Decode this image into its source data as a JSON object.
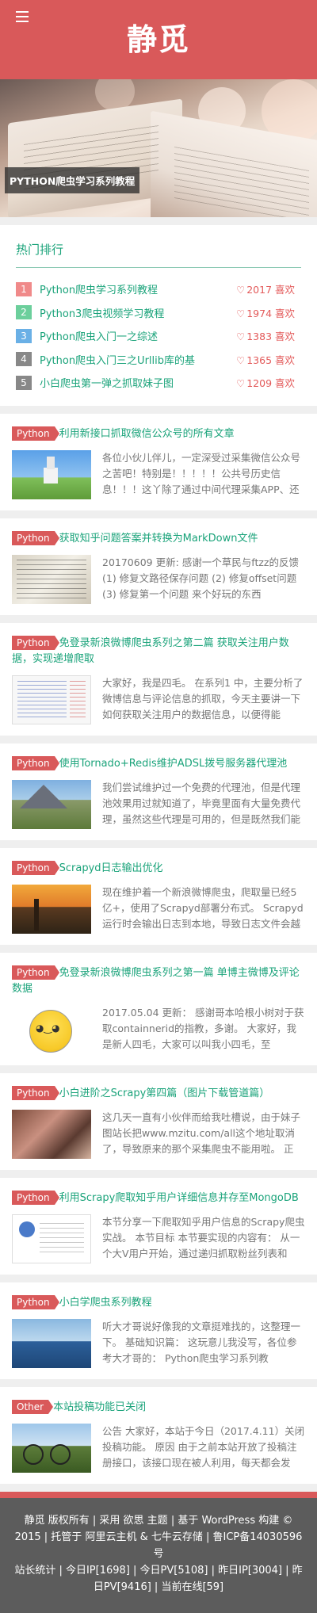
{
  "site": {
    "title": "静觅"
  },
  "banner": {
    "caption": "PYTHON爬虫学习系列教程"
  },
  "hot": {
    "title": "热门排行",
    "items": [
      {
        "rank": "1",
        "title": "Python爬虫学习系列教程",
        "likes": "2017 喜欢",
        "color": "#f08a8a"
      },
      {
        "rank": "2",
        "title": "Python3爬虫视频学习教程",
        "likes": "1974 喜欢",
        "color": "#6ccf9c"
      },
      {
        "rank": "3",
        "title": "Python爬虫入门一之综述",
        "likes": "1383 喜欢",
        "color": "#6ab0e6"
      },
      {
        "rank": "4",
        "title": "Python爬虫入门三之Urllib库的基",
        "likes": "1365 喜欢",
        "color": "#888888"
      },
      {
        "rank": "5",
        "title": "小白爬虫第一弹之抓取妹子图",
        "likes": "1209 喜欢",
        "color": "#888888"
      }
    ]
  },
  "posts": [
    {
      "category": "Python",
      "title": "利用新接口抓取微信公众号的所有文章",
      "excerpt": "各位小伙儿伴儿，一定深受过采集微信公众号之苦吧！特别是！！！！！公共号历史信息！！！这丫除了通过中间代理采集APP、还",
      "thumb": "t-church"
    },
    {
      "category": "Python",
      "title": "获取知乎问题答案并转换为MarkDown文件",
      "excerpt": "20170609 更新: 感谢一个草民与ftzz的反馈 (1) 修复文路径保存问题 (2) 修复offset问题 (3) 修复第一个问题 来个好玩的东西",
      "thumb": "t-notes"
    },
    {
      "category": "Python",
      "title": "免登录新浪微博爬虫系列之第二篇 获取关注用户数据，实现递增爬取",
      "excerpt": "大家好，我是四毛。 在系列1 中，主要分析了微博信息与评论信息的抓取，今天主要讲一下如何获取关注用户的数据信息，以便得能",
      "thumb": "t-code"
    },
    {
      "category": "Python",
      "title": "使用Tornado+Redis维护ADSL拨号服务器代理池",
      "excerpt": "我们尝试维护过一个免费的代理池，但是代理池效果用过就知道了，毕竟里面有大量免费代理，虽然这些代理是可用的，但是既然我们能",
      "thumb": "t-mountain"
    },
    {
      "category": "Python",
      "title": "Scrapyd日志输出优化",
      "excerpt": "现在维护着一个新浪微博爬虫，爬取量已经5亿+，使用了Scrapyd部署分布式。 Scrapyd运行时会输出日志到本地，导致日志文件会越",
      "thumb": "t-sunset"
    },
    {
      "category": "Python",
      "title": "免登录新浪微博爬虫系列之第一篇 单博主微博及评论数据",
      "excerpt": "2017.05.04 更新： 感谢哥本哈根小树对于获取containnerid的指教，多谢。 大家好，我是新人四毛，大家可以叫我小四毛，至",
      "thumb": "t-face"
    },
    {
      "category": "Python",
      "title": "小白进阶之Scrapy第四篇（图片下载管道篇）",
      "excerpt": "这几天一直有小伙伴而给我吐槽说，由于妹子图站长把www.mzitu.com/all这个地址取消了，导致原来的那个采集爬虫不能用啦。 正",
      "thumb": "t-girl"
    },
    {
      "category": "Python",
      "title": "利用Scrapy爬取知乎用户详细信息并存至MongoDB",
      "excerpt": "本节分享一下爬取知乎用户信息的Scrapy爬虫实战。 本节目标 本节要实现的内容有： 从一个大V用户开始，通过递归抓取粉丝列表和",
      "thumb": "t-profile"
    },
    {
      "category": "Python",
      "title": "小白学爬虫系列教程",
      "excerpt": "听大才哥说好像我的文章挺难找的，这整理一下。 基础知识篇： 这玩意儿我没写，各位参考大才哥的： Python爬虫学习系列教",
      "thumb": "t-coast"
    },
    {
      "category": "Other",
      "title": "本站投稿功能已关闭",
      "excerpt": "公告 大家好，本站于今日（2017.4.11）关闭投稿功能。 原因 由于之前本站开放了投稿注册接口，该接口现在被人利用，每天都会发",
      "thumb": "t-bikes"
    }
  ],
  "footer": {
    "copyright": "静觅 版权所有 | 采用 欲思 主题 | 基于 WordPress 构建 © 2015 | 托管于 阿里云主机 & 七牛云存储 | 鲁ICP备14030596号",
    "stats": "站长统计 | 今日IP[1698] | 今日PV[5108] | 昨日IP[3004] | 昨日PV[9416] | 当前在线[59]"
  },
  "colors": {
    "brand": "#d9595a",
    "accent": "#1aa37a"
  }
}
